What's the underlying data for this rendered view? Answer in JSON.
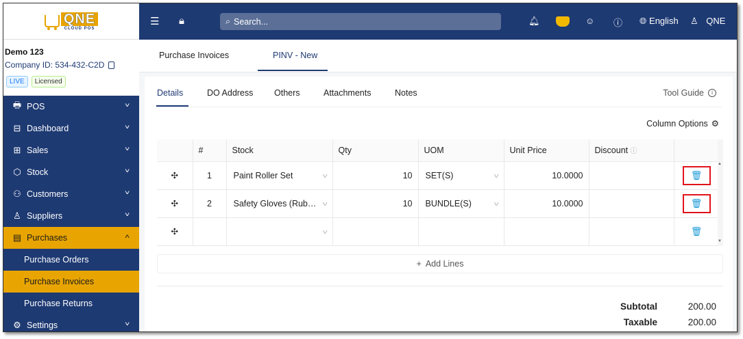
{
  "logo": {
    "main": "QNE",
    "sub": "CLOUD POS"
  },
  "company": {
    "name": "Demo 123",
    "id_label": "Company ID: 534-432-C2D",
    "badges": [
      "LIVE",
      "Licensed"
    ]
  },
  "sidebar": {
    "items": [
      {
        "label": "POS",
        "icon": "pos-icon",
        "chevron": "˅"
      },
      {
        "label": "Dashboard",
        "icon": "dashboard-icon",
        "chevron": "˅"
      },
      {
        "label": "Sales",
        "icon": "sales-cart-icon",
        "chevron": "˅"
      },
      {
        "label": "Stock",
        "icon": "stock-box-icon",
        "chevron": "˅"
      },
      {
        "label": "Customers",
        "icon": "customers-icon",
        "chevron": "˅"
      },
      {
        "label": "Suppliers",
        "icon": "suppliers-icon",
        "chevron": "˅"
      },
      {
        "label": "Purchases",
        "icon": "purchases-icon",
        "chevron": "˄"
      },
      {
        "label": "Settings",
        "icon": "settings-icon",
        "chevron": "˅"
      }
    ],
    "purchases_sub": [
      "Purchase Orders",
      "Purchase Invoices",
      "Purchase Returns"
    ]
  },
  "topbar": {
    "search_placeholder": "Search...",
    "language": "English",
    "user": "QNE"
  },
  "top_tabs": [
    "Purchase Invoices",
    "PINV - New"
  ],
  "detail_tabs": [
    "Details",
    "DO Address",
    "Others",
    "Attachments",
    "Notes"
  ],
  "tool_guide": "Tool Guide",
  "column_options": "Column Options",
  "table": {
    "headers": {
      "no": "#",
      "stock": "Stock",
      "qty": "Qty",
      "uom": "UOM",
      "price": "Unit Price",
      "discount": "Discount"
    },
    "rows": [
      {
        "no": "1",
        "stock": "Paint Roller Set",
        "qty": "10",
        "uom": "SET(S)",
        "price": "10.0000"
      },
      {
        "no": "2",
        "stock": "Safety Gloves (Rub…",
        "qty": "10",
        "uom": "BUNDLE(S)",
        "price": "10.0000"
      }
    ]
  },
  "add_lines": "Add Lines",
  "totals": {
    "subtotal_label": "Subtotal",
    "subtotal": "200.00",
    "taxable_label": "Taxable",
    "taxable": "200.00"
  },
  "colors": {
    "navy": "#1e3a73",
    "accent": "#e8a400",
    "highlight": "#e0131a",
    "trash": "#1a9bd7"
  }
}
